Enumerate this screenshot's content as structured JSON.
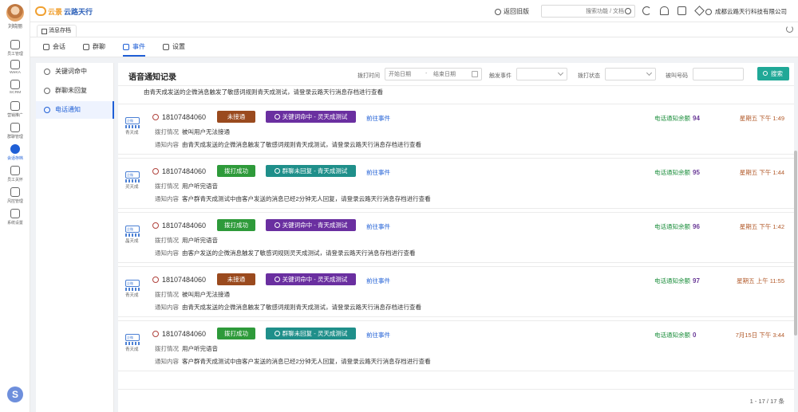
{
  "user": {
    "name": "刘晓丽"
  },
  "rail": [
    {
      "label": "员工管理",
      "active": false
    },
    {
      "label": "WeKA",
      "active": false
    },
    {
      "label": "SCRM",
      "active": false
    },
    {
      "label": "营销推广",
      "active": false
    },
    {
      "label": "群聊管理",
      "active": false
    },
    {
      "label": "会话存档",
      "active": true
    },
    {
      "label": "员工关怀",
      "active": false
    },
    {
      "label": "风控管理",
      "active": false
    },
    {
      "label": "系统设置",
      "active": false
    }
  ],
  "brand": {
    "part1": "云景",
    "part2": "云路天行"
  },
  "topbar": {
    "back_old": "返回旧版",
    "search_placeholder": "搜索功能 / 文档",
    "company": "成都云路天行科技有限公司"
  },
  "page_tab": "消息存档",
  "subtabs": [
    {
      "label": "会话",
      "active": false
    },
    {
      "label": "群聊",
      "active": false
    },
    {
      "label": "事件",
      "active": true
    },
    {
      "label": "设置",
      "active": false
    }
  ],
  "left_menu": [
    {
      "label": "关键词命中",
      "active": false
    },
    {
      "label": "群聊未回复",
      "active": false
    },
    {
      "label": "电话通知",
      "active": true
    }
  ],
  "main": {
    "title": "语音通知记录",
    "filters": {
      "call_time_label": "拨打时间",
      "start_placeholder": "开始日期",
      "range_sep": "-",
      "end_placeholder": "结束日期",
      "trigger_event_label": "触发事件",
      "call_status_label": "拨打状态",
      "number_label": "被叫号码",
      "query_button": "搜索"
    },
    "partial_top_text": "由青天成发送的企微消息触发了敏感词规则青天成测试，请登录云路天行消息存档进行查看",
    "labels": {
      "call_status": "拨打情况",
      "notify_content": "通知内容",
      "goto_event": "前往事件",
      "remaining": "电话通知余额"
    },
    "records": [
      {
        "person": "青天成",
        "phone": "18107484060",
        "status": "未接通",
        "status_color": "#9a4a1e",
        "event": "关键词命中 - 灵天成测试",
        "event_color": "#6a2fa0",
        "event_icon": "search-icon",
        "call_detail": "被叫用户无法接通",
        "content": "由青天成发送的企微消息触发了敏感词规则青天成测试，请登录云路天行消息存档进行查看",
        "balance": "94",
        "time": "星期五 下午 1:49"
      },
      {
        "person": "灵天成",
        "phone": "18107484060",
        "status": "拨打成功",
        "status_color": "#2e9a3a",
        "event": "群聊未回复 - 青天成测试",
        "event_color": "#1f8f8a",
        "event_icon": "group-icon",
        "call_detail": "用户听完语音",
        "content": "客户群青天成测试中由客户发送的消息已经2分钟无人回复，请登录云路天行消息存档进行查看",
        "balance": "95",
        "time": "星期五 下午 1:44"
      },
      {
        "person": "晶天成",
        "phone": "18107484060",
        "status": "拨打成功",
        "status_color": "#2e9a3a",
        "event": "关键词命中 - 青天成测试",
        "event_color": "#6a2fa0",
        "event_icon": "search-icon",
        "call_detail": "用户听完语音",
        "content": "由客户发送的企微消息触发了敏感词规则灵天成测试，请登录云路天行消息存档进行查看",
        "balance": "96",
        "time": "星期五 下午 1:42"
      },
      {
        "person": "青天成",
        "phone": "18107484060",
        "status": "未接通",
        "status_color": "#9a4a1e",
        "event": "关键词命中 - 灵天成测试",
        "event_color": "#6a2fa0",
        "event_icon": "search-icon",
        "call_detail": "被叫用户无法接通",
        "content": "由青天成发送的企微消息触发了敏感词规则青天成测试，请登录云路天行消息存档进行查看",
        "balance": "97",
        "time": "星期五 上午 11:55"
      },
      {
        "person": "青天成",
        "phone": "18107484060",
        "status": "拨打成功",
        "status_color": "#2e9a3a",
        "event": "群聊未回复 - 灵天成测试",
        "event_color": "#1f8f8a",
        "event_icon": "group-icon",
        "call_detail": "用户听完语音",
        "content": "客户群青天成测试中由客户发送的消息已经2分钟无人回复，请登录云路天行消息存档进行查看",
        "balance": "0",
        "time": "7月15日 下午 3:44"
      }
    ],
    "pager": "1 - 17 / 17 条"
  }
}
